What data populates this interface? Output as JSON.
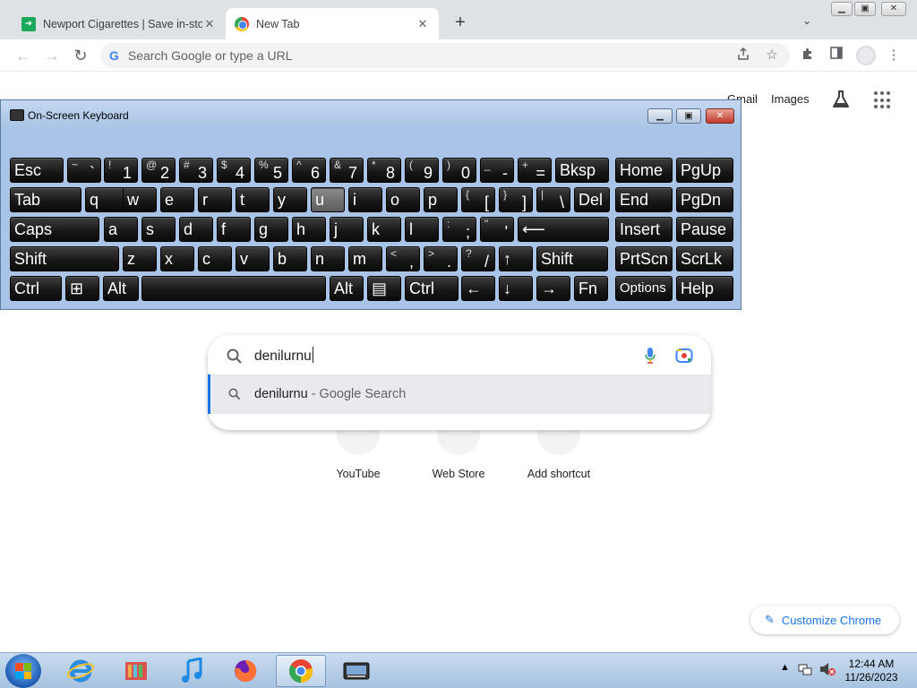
{
  "browser": {
    "tabs": [
      {
        "title": "Newport Cigarettes | Save in-store",
        "close": "✕"
      },
      {
        "title": "New Tab",
        "close": "✕"
      }
    ],
    "new_tab_symbol": "+",
    "tab_search_symbol": "⌄",
    "window_controls": {
      "minimize": "▁",
      "maximize": "▣",
      "close": "✕"
    },
    "nav": {
      "back": "←",
      "forward": "→",
      "reload": "↻"
    },
    "omnibox": {
      "google_glyph": "G",
      "placeholder": "Search Google or type a URL"
    }
  },
  "ntp": {
    "links": {
      "gmail": "Gmail",
      "images": "Images"
    },
    "search": {
      "query": "denilurnu",
      "suggestion": {
        "text": "denilurnu",
        "suffix": " - Google Search"
      }
    },
    "shortcuts": [
      {
        "label": "YouTube"
      },
      {
        "label": "Web Store"
      },
      {
        "label": "Add shortcut"
      }
    ],
    "customize": {
      "label": "Customize Chrome",
      "icon_glyph": "✎"
    }
  },
  "osk": {
    "title": "On-Screen Keyboard",
    "title_buttons": {
      "minimize": "▁",
      "restore": "▣",
      "close": "✕"
    },
    "rows": [
      [
        {
          "label": "Esc"
        },
        {
          "sub": "~",
          "main": "`"
        },
        {
          "sub": "!",
          "main": "1"
        },
        {
          "sub": "@",
          "main": "2"
        },
        {
          "sub": "#",
          "main": "3"
        },
        {
          "sub": "$",
          "main": "4"
        },
        {
          "sub": "%",
          "main": "5"
        },
        {
          "sub": "^",
          "main": "6"
        },
        {
          "sub": "&",
          "main": "7"
        },
        {
          "sub": "*",
          "main": "8"
        },
        {
          "sub": "(",
          "main": "9"
        },
        {
          "sub": ")",
          "main": "0"
        },
        {
          "sub": "_",
          "main": "-"
        },
        {
          "sub": "+",
          "main": "="
        },
        {
          "label": "Bksp"
        },
        {
          "label": "Home"
        },
        {
          "label": "PgUp"
        }
      ],
      [
        {
          "label": "Tab"
        },
        {
          "label": "q"
        },
        {
          "label": "w"
        },
        {
          "label": "e"
        },
        {
          "label": "r"
        },
        {
          "label": "t"
        },
        {
          "label": "y"
        },
        {
          "label": "u",
          "pressed": true
        },
        {
          "label": "i"
        },
        {
          "label": "o"
        },
        {
          "label": "p"
        },
        {
          "sub": "{",
          "main": "["
        },
        {
          "sub": "}",
          "main": "]"
        },
        {
          "sub": "|",
          "main": "\\"
        },
        {
          "label": "Del"
        },
        {
          "label": "End"
        },
        {
          "label": "PgDn"
        }
      ],
      [
        {
          "label": "Caps"
        },
        {
          "label": "a"
        },
        {
          "label": "s"
        },
        {
          "label": "d"
        },
        {
          "label": "f"
        },
        {
          "label": "g"
        },
        {
          "label": "h"
        },
        {
          "label": "j"
        },
        {
          "label": "k"
        },
        {
          "label": "l"
        },
        {
          "sub": ":",
          "main": ";"
        },
        {
          "sub": "\"",
          "main": "'"
        },
        {
          "label": "⟵"
        },
        {
          "label": "Insert"
        },
        {
          "label": "Pause"
        }
      ],
      [
        {
          "label": "Shift"
        },
        {
          "label": "z"
        },
        {
          "label": "x"
        },
        {
          "label": "c"
        },
        {
          "label": "v"
        },
        {
          "label": "b"
        },
        {
          "label": "n"
        },
        {
          "label": "m"
        },
        {
          "sub": "<",
          "main": ","
        },
        {
          "sub": ">",
          "main": "."
        },
        {
          "sub": "?",
          "main": "/"
        },
        {
          "label": "↑"
        },
        {
          "label": "Shift"
        },
        {
          "label": "PrtScn"
        },
        {
          "label": "ScrLk"
        }
      ],
      [
        {
          "label": "Ctrl"
        },
        {
          "label": "⊞"
        },
        {
          "label": "Alt"
        },
        {
          "label": ""
        },
        {
          "label": "Alt"
        },
        {
          "label": "▤"
        },
        {
          "label": "Ctrl"
        },
        {
          "label": "←"
        },
        {
          "label": "↓"
        },
        {
          "label": "→"
        },
        {
          "label": "Fn"
        },
        {
          "label": "Options"
        },
        {
          "label": "Help"
        }
      ]
    ]
  },
  "taskbar": {
    "apps": [
      {
        "name": "internet-explorer-icon"
      },
      {
        "name": "library-icon"
      },
      {
        "name": "itunes-icon"
      },
      {
        "name": "firefox-icon"
      },
      {
        "name": "chrome-icon",
        "active": true
      },
      {
        "name": "osk-icon"
      }
    ],
    "clock": {
      "time": "12:44 AM",
      "date": "11/26/2023"
    },
    "tray_show_hidden": "▲"
  }
}
